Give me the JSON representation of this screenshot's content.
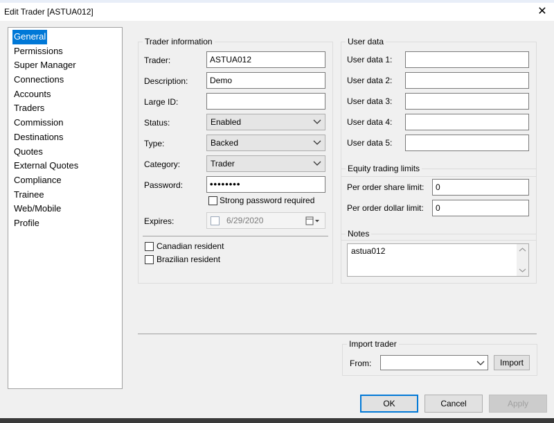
{
  "window": {
    "title": "Edit Trader [ASTUA012]"
  },
  "nav": {
    "selected_index": 0,
    "items": [
      "General",
      "Permissions",
      "Super Manager",
      "Connections",
      "Accounts",
      "Traders",
      "Commission",
      "Destinations",
      "Quotes",
      "External Quotes",
      "Compliance",
      "Trainee",
      "Web/Mobile",
      "Profile"
    ]
  },
  "trader_info": {
    "title": "Trader information",
    "trader_label": "Trader:",
    "trader_value": "ASTUA012",
    "description_label": "Description:",
    "description_value": "Demo",
    "large_id_label": "Large ID:",
    "large_id_value": "",
    "status_label": "Status:",
    "status_value": "Enabled",
    "type_label": "Type:",
    "type_value": "Backed",
    "category_label": "Category:",
    "category_value": "Trader",
    "password_label": "Password:",
    "password_value": "••••••••",
    "strong_password_label": "Strong password required",
    "expires_label": "Expires:",
    "expires_value": "6/29/2020",
    "canadian_label": "Canadian resident",
    "brazilian_label": "Brazilian resident"
  },
  "user_data": {
    "title": "User data",
    "labels": [
      "User data 1:",
      "User data 2:",
      "User data 3:",
      "User data 4:",
      "User data 5:"
    ],
    "values": [
      "",
      "",
      "",
      "",
      ""
    ]
  },
  "equity": {
    "title": "Equity trading limits",
    "share_label": "Per order share limit:",
    "share_value": "0",
    "dollar_label": "Per order dollar limit:",
    "dollar_value": "0"
  },
  "notes": {
    "title": "Notes",
    "value": "astua012"
  },
  "import": {
    "title": "Import trader",
    "from_label": "From:",
    "from_value": "",
    "import_label": "Import"
  },
  "buttons": {
    "ok": "OK",
    "cancel": "Cancel",
    "apply": "Apply"
  }
}
